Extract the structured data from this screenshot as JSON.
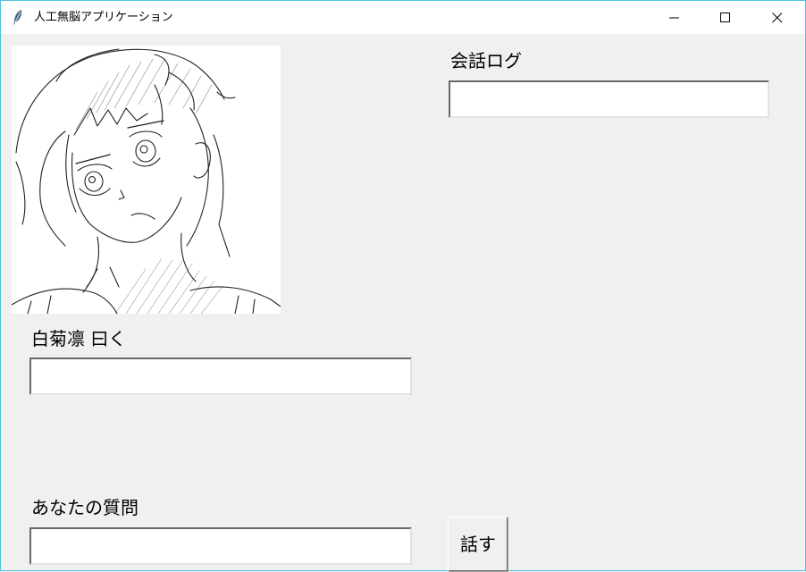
{
  "window": {
    "title": "人工無脳アプリケーション",
    "icon": "feather-icon",
    "controls": {
      "minimize_icon": "minimize-icon",
      "maximize_icon": "maximize-icon",
      "close_icon": "close-icon"
    }
  },
  "portrait": {
    "icon": "character-portrait-sketch"
  },
  "conversation_log": {
    "label": "会話ログ",
    "value": ""
  },
  "reply": {
    "label": "白菊凛 曰く",
    "value": ""
  },
  "question": {
    "label": "あなたの質問",
    "value": ""
  },
  "talk_button": {
    "label": "話す"
  }
}
